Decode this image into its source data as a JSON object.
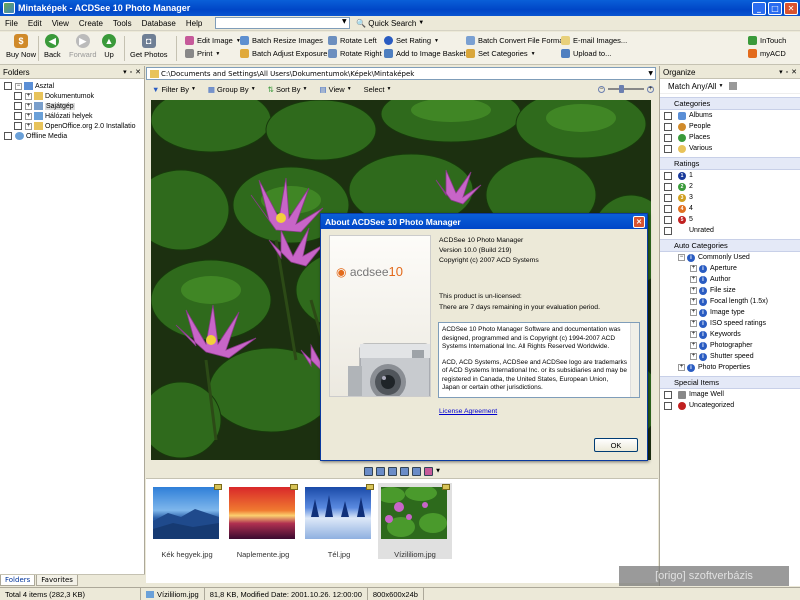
{
  "window": {
    "title": "Mintaképek - ACDSee 10 Photo Manager"
  },
  "menu": {
    "items": [
      "File",
      "Edit",
      "View",
      "Create",
      "Tools",
      "Database",
      "Help"
    ],
    "search_value": "",
    "quick_search": "Quick Search"
  },
  "toolbar": {
    "buy_now": "Buy Now",
    "back": "Back",
    "forward": "Forward",
    "up": "Up",
    "get_photos": "Get Photos",
    "edit_image": "Edit Image",
    "print": "Print",
    "batch_resize": "Batch Resize Images",
    "batch_exposure": "Batch Adjust Exposure",
    "rotate_left": "Rotate Left",
    "rotate_right": "Rotate Right",
    "set_rating": "Set Rating",
    "add_basket": "Add to Image Basket",
    "batch_convert": "Batch Convert File Format",
    "set_categories": "Set Categories",
    "email_images": "E-mail Images...",
    "upload_to": "Upload to...",
    "intouch": "InTouch",
    "myacd": "myACD"
  },
  "folders": {
    "title": "Folders",
    "tree": [
      {
        "label": "Asztal",
        "level": 0,
        "expander": "−"
      },
      {
        "label": "Dokumentumok",
        "level": 1,
        "expander": "+"
      },
      {
        "label": "Sajátgép",
        "level": 1,
        "expander": "+"
      },
      {
        "label": "Hálózati helyek",
        "level": 1,
        "expander": "+"
      },
      {
        "label": "OpenOffice.org 2.0 Installatio",
        "level": 1,
        "expander": "+"
      },
      {
        "label": "Offline Media",
        "level": 0,
        "expander": ""
      }
    ],
    "tabs": [
      "Folders",
      "Favorites"
    ]
  },
  "browser": {
    "path": "C:\\Documents and Settings\\All Users\\Dokumentumok\\Képek\\Mintaképek",
    "filter_by": "Filter By",
    "group_by": "Group By",
    "sort_by": "Sort By",
    "view": "View",
    "select": "Select"
  },
  "thumbnails": [
    {
      "label": "Kék hegyek.jpg",
      "selected": false
    },
    {
      "label": "Naplemente.jpg",
      "selected": false
    },
    {
      "label": "Tél.jpg",
      "selected": false
    },
    {
      "label": "Vízililiom.jpg",
      "selected": true
    }
  ],
  "organize": {
    "title": "Organize",
    "match": "Match Any/All",
    "categories_title": "Categories",
    "categories": [
      "Albums",
      "People",
      "Places",
      "Various"
    ],
    "ratings_title": "Ratings",
    "ratings": [
      "1",
      "2",
      "3",
      "4",
      "5",
      "Unrated"
    ],
    "auto_title": "Auto Categories",
    "auto_root": "Commonly Used",
    "auto_items": [
      "Aperture",
      "Author",
      "File size",
      "Focal length (1.5x)",
      "Image type",
      "ISO speed ratings",
      "Keywords",
      "Photographer",
      "Shutter speed"
    ],
    "photo_properties": "Photo Properties",
    "special_title": "Special Items",
    "special": [
      "Image Well",
      "Uncategorized"
    ]
  },
  "dialog": {
    "title": "About ACDSee 10 Photo Manager",
    "product": "ACDSee 10 Photo Manager",
    "version": "Version 10.0 (Build 219)",
    "copyright": "Copyright (c) 2007 ACD Systems",
    "unlicensed": "This product is un-licensed:",
    "trial": "There are 7 days remaining in your evaluation period.",
    "license_p1": "ACDSee 10 Photo Manager Software and documentation was designed, programmed and is Copyright (c) 1994-2007 ACD Systems International Inc. All Rights Reserved Worldwide.",
    "license_p2": "ACD, ACD Systems, ACDSee and ACDSee logo are trademarks of ACD Systems International Inc. or its subsidiaries and may be registered in Canada, the United States, European Union, Japan  or certain other jurisdictions.",
    "license_link": "License Agreement",
    "ok": "OK",
    "logo_text": "acdsee",
    "logo_num": "10"
  },
  "status": {
    "total": "Total 4 items  (282,3 KB)",
    "file": "Vízililiom.jpg",
    "info": "81,8 KB, Modified Date: 2001.10.26. 12:00:00",
    "dims": "800x600x24b"
  },
  "watermark": "[origo] szoftverbázis",
  "colors": {
    "titlebar": "#0046c7",
    "accent": "#e36b1c",
    "link": "#0000cc"
  }
}
